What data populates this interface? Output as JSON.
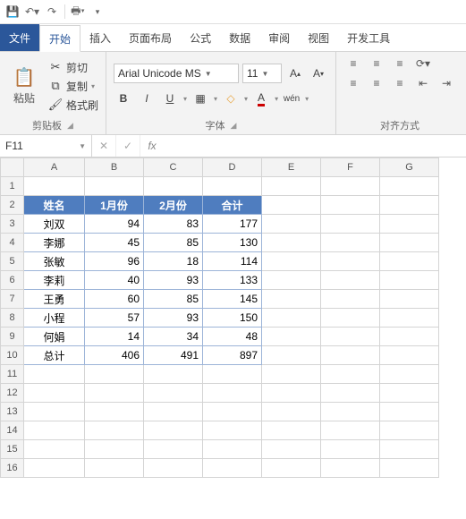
{
  "qat": {
    "save": "保存",
    "undo": "撤销",
    "redo": "重做",
    "print": "打印"
  },
  "tabs": {
    "file": "文件",
    "home": "开始",
    "insert": "插入",
    "layout": "页面布局",
    "formula": "公式",
    "data": "数据",
    "review": "审阅",
    "view": "视图",
    "dev": "开发工具"
  },
  "ribbon": {
    "clipboard": {
      "paste": "粘贴",
      "cut": "剪切",
      "copy": "复制",
      "format": "格式刷",
      "label": "剪贴板"
    },
    "font": {
      "name": "Arial Unicode MS",
      "size": "11",
      "label": "字体",
      "bold": "B",
      "italic": "I",
      "underline": "U",
      "wen": "wén"
    },
    "align": {
      "label": "对齐方式"
    }
  },
  "namebox": {
    "cell": "F11",
    "fx": "fx"
  },
  "columns": [
    "A",
    "B",
    "C",
    "D",
    "E",
    "F",
    "G"
  ],
  "rows": [
    "1",
    "2",
    "3",
    "4",
    "5",
    "6",
    "7",
    "8",
    "9",
    "10",
    "11",
    "12",
    "13",
    "14",
    "15",
    "16"
  ],
  "table": {
    "headers": [
      "姓名",
      "1月份",
      "2月份",
      "合计"
    ],
    "data": [
      [
        "刘双",
        94,
        83,
        177
      ],
      [
        "李娜",
        45,
        85,
        130
      ],
      [
        "张敏",
        96,
        18,
        114
      ],
      [
        "李莉",
        40,
        93,
        133
      ],
      [
        "王勇",
        60,
        85,
        145
      ],
      [
        "小程",
        57,
        93,
        150
      ],
      [
        "何娟",
        14,
        34,
        48
      ],
      [
        "总计",
        406,
        491,
        897
      ]
    ]
  },
  "chart_data": {
    "type": "table",
    "title": "",
    "columns": [
      "姓名",
      "1月份",
      "2月份",
      "合计"
    ],
    "rows": [
      {
        "姓名": "刘双",
        "1月份": 94,
        "2月份": 83,
        "合计": 177
      },
      {
        "姓名": "李娜",
        "1月份": 45,
        "2月份": 85,
        "合计": 130
      },
      {
        "姓名": "张敏",
        "1月份": 96,
        "2月份": 18,
        "合计": 114
      },
      {
        "姓名": "李莉",
        "1月份": 40,
        "2月份": 93,
        "合计": 133
      },
      {
        "姓名": "王勇",
        "1月份": 60,
        "2月份": 85,
        "合计": 145
      },
      {
        "姓名": "小程",
        "1月份": 57,
        "2月份": 93,
        "合计": 150
      },
      {
        "姓名": "何娟",
        "1月份": 14,
        "2月份": 34,
        "合计": 48
      },
      {
        "姓名": "总计",
        "1月份": 406,
        "2月份": 491,
        "合计": 897
      }
    ]
  }
}
